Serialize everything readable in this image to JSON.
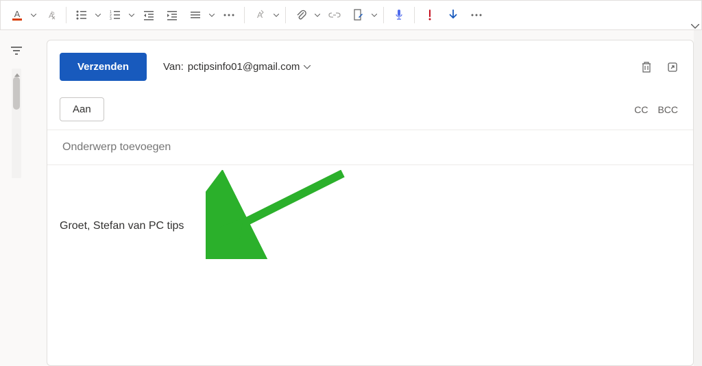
{
  "toolbar": {
    "icons": {
      "font_color": "font-color-icon",
      "clear_format": "clear-format-icon",
      "bullets": "bullets-icon",
      "numbering": "numbering-icon",
      "outdent": "outdent-icon",
      "indent": "indent-icon",
      "line_spacing": "line-spacing-icon",
      "more1": "more-icon",
      "styles": "styles-icon",
      "attach": "attach-icon",
      "link": "link-icon",
      "signature": "signature-icon",
      "dictate": "dictate-icon",
      "importance": "importance-icon",
      "download": "download-icon",
      "more2": "more-icon"
    }
  },
  "compose": {
    "send_label": "Verzenden",
    "from_label": "Van:",
    "from_email": "pctipsinfo01@gmail.com",
    "to_label": "Aan",
    "cc_label": "CC",
    "bcc_label": "BCC",
    "subject_placeholder": "Onderwerp toevoegen",
    "body_signature": "Groet, Stefan van PC tips"
  },
  "colors": {
    "primary": "#185abd",
    "arrow": "#2bb02b"
  }
}
